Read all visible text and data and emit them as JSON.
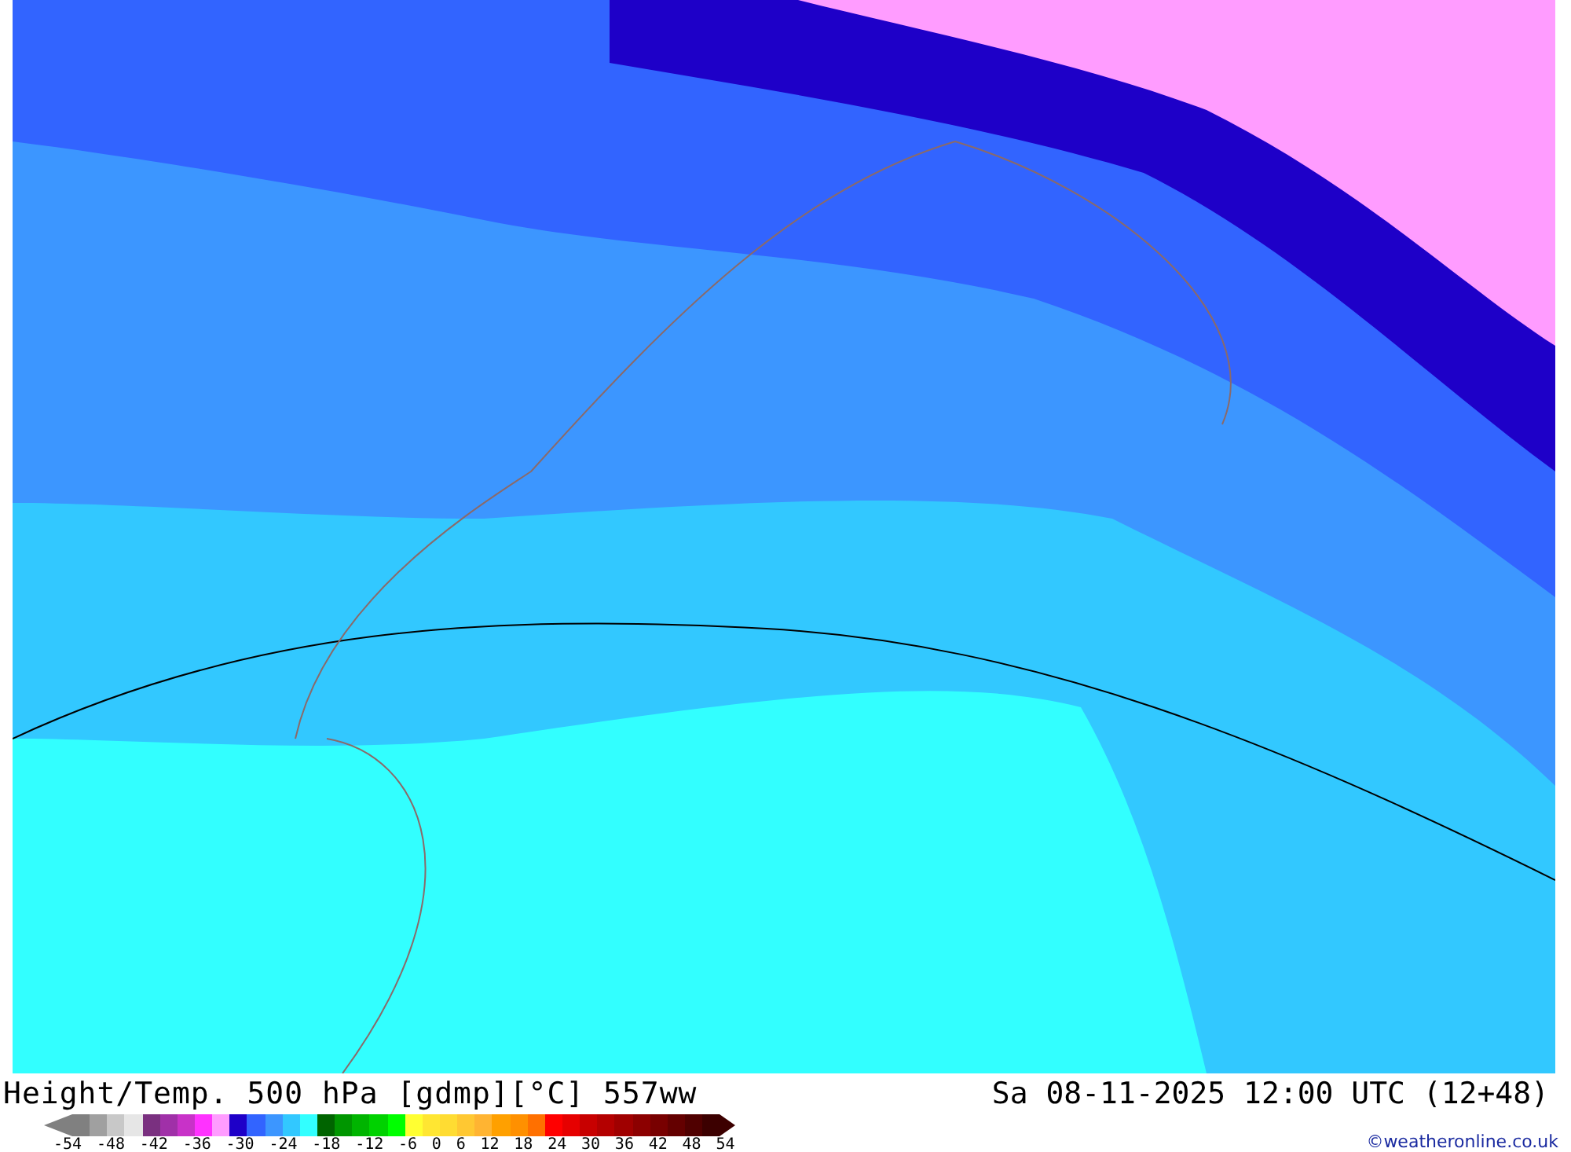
{
  "map": {
    "title": "Height/Temp. 500 hPa [gdmp][°C] 557ww",
    "valid_time": "Sa 08-11-2025 12:00 UTC (12+48)"
  },
  "legend": {
    "swatches": [
      {
        "color": "#808080"
      },
      {
        "color": "#a0a0a0"
      },
      {
        "color": "#c8c8c8"
      },
      {
        "color": "#e6e6e6"
      },
      {
        "color": "#7a3080"
      },
      {
        "color": "#a030a8"
      },
      {
        "color": "#c832c8"
      },
      {
        "color": "#ff32ff"
      },
      {
        "color": "#ff9cff"
      },
      {
        "color": "#1e00c8"
      },
      {
        "color": "#3264ff"
      },
      {
        "color": "#3c96ff"
      },
      {
        "color": "#32c8ff"
      },
      {
        "color": "#32ffff"
      },
      {
        "color": "#006400"
      },
      {
        "color": "#009600"
      },
      {
        "color": "#00b400"
      },
      {
        "color": "#00d200"
      },
      {
        "color": "#00ff00"
      },
      {
        "color": "#ffff32"
      },
      {
        "color": "#ffe632"
      },
      {
        "color": "#ffdc32"
      },
      {
        "color": "#ffc832"
      },
      {
        "color": "#ffb432"
      },
      {
        "color": "#ffa000"
      },
      {
        "color": "#ff9000"
      },
      {
        "color": "#ff7000"
      },
      {
        "color": "#ff0000"
      },
      {
        "color": "#e60000"
      },
      {
        "color": "#c80000"
      },
      {
        "color": "#b40000"
      },
      {
        "color": "#a00000"
      },
      {
        "color": "#8c0000"
      },
      {
        "color": "#780000"
      },
      {
        "color": "#640000"
      },
      {
        "color": "#500000"
      },
      {
        "color": "#3c0000"
      }
    ],
    "labels": [
      "-54",
      "-48",
      "-42",
      "-36",
      "-30",
      "-24",
      "-18",
      "-12",
      "-6",
      "0",
      "6",
      "12",
      "18",
      "24",
      "30",
      "36",
      "42",
      "48",
      "54"
    ]
  },
  "credit": "©weatheronline.co.uk"
}
